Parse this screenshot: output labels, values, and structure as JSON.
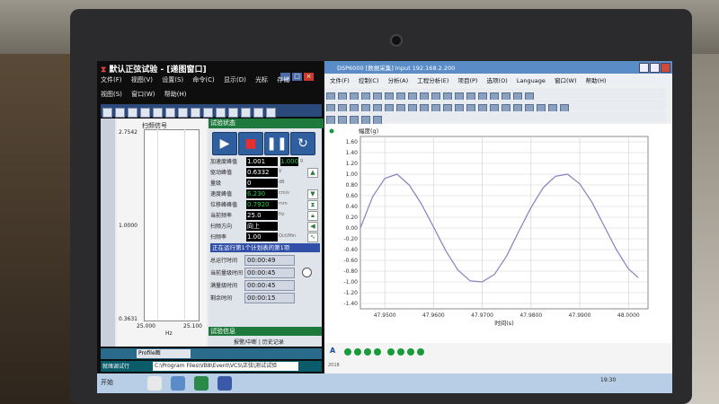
{
  "left_app": {
    "title": "默认正弦试验 - [递图窗口]",
    "menu1": [
      "文件(F)",
      "视图(V)",
      "设置(S)",
      "命令(C)",
      "显示(D)",
      "光标",
      "存储"
    ],
    "menu2": [
      "视图(S)",
      "窗口(W)",
      "帮助(H)"
    ],
    "plot": {
      "title": "扫频信号",
      "y_top": "2.7542",
      "y_mid": "1.0000",
      "y_bottom": "0.3631",
      "x_left": "25.000",
      "x_right": "25.100",
      "x_unit": "Hz"
    },
    "panel_header": "试验状态",
    "controls": [
      "play",
      "stop",
      "pause",
      "restart"
    ],
    "rows": [
      {
        "label": "加速度峰值",
        "value": "1.001",
        "value2": "1.000",
        "unit": "g"
      },
      {
        "label": "驱动峰值",
        "value": "0.6332",
        "unit": "V"
      },
      {
        "label": "量级",
        "value": "0",
        "unit": "dB"
      },
      {
        "label": "速度峰值",
        "value": "6.230",
        "unit": "cm/s"
      },
      {
        "label": "位移峰峰值",
        "value": "0.7920",
        "unit": "mm"
      },
      {
        "label": "当前频率",
        "value": "25.0",
        "unit": "Hz"
      },
      {
        "label": "扫频方向",
        "value": "向上",
        "unit": ""
      },
      {
        "label": "扫频率",
        "value": "1.00",
        "unit": "Oct/Min"
      }
    ],
    "schedule": "正在运行第1个计划表的第1项",
    "timers": [
      {
        "label": "总运行时间",
        "value": "00:00:49"
      },
      {
        "label": "当前量级时间",
        "value": "00:00:45"
      },
      {
        "label": "满量级时间",
        "value": "00:00:45"
      },
      {
        "label": "剩余时间",
        "value": "00:00:15"
      }
    ],
    "info_header": "试验信息",
    "info_tabs": "报警/中断  |  历史记录",
    "profile": "Profile图",
    "status_left": "就绪调试行",
    "status_path": "C:\\Program Files\\VB8\\Event\\VCS\\正弦\\测试试验"
  },
  "right_app": {
    "title": "DSP6000  [数据采集]  Input 192.168.2.200",
    "menu": [
      "文件(F)",
      "控制(C)",
      "分析(A)",
      "工程分析(E)",
      "项目(P)",
      "选项(O)",
      "Language",
      "窗口(W)",
      "帮助(H)"
    ],
    "status_marker": "A",
    "status_small": "2018",
    "dot_color": "#1a9a3a"
  },
  "chart_data": {
    "type": "line",
    "ylabel": "幅度(g)",
    "xlabel": "时间(s)",
    "yticks": [
      "1.60",
      "1.40",
      "1.20",
      "1.00",
      "0.80",
      "0.60",
      "0.40",
      "0.20",
      "0.00",
      "-0.20",
      "-0.40",
      "-0.60",
      "-0.80",
      "-1.00",
      "-1.20",
      "-1.40"
    ],
    "xticks": [
      "47.9500",
      "47.9600",
      "47.9700",
      "47.9800",
      "47.9900",
      "48.0000"
    ],
    "ylim": [
      -1.5,
      1.7
    ],
    "xlim": [
      47.945,
      48.004
    ],
    "series": [
      {
        "x": [
          47.945,
          47.9475,
          47.95,
          47.9525,
          47.955,
          47.9575,
          47.96,
          47.9625,
          47.965,
          47.9675,
          47.97,
          47.9725,
          47.975,
          47.9775,
          47.98,
          47.9825,
          47.985,
          47.9875,
          47.99,
          47.9925,
          47.995,
          47.9975,
          48.0,
          48.002
        ],
        "y": [
          0.0,
          0.58,
          0.92,
          1.0,
          0.8,
          0.45,
          0.02,
          -0.42,
          -0.78,
          -0.98,
          -1.0,
          -0.86,
          -0.52,
          -0.06,
          0.38,
          0.75,
          0.96,
          1.0,
          0.82,
          0.48,
          0.04,
          -0.4,
          -0.76,
          -0.92
        ]
      }
    ],
    "grid": true,
    "line_color": "#8a7fbf"
  },
  "taskbar": {
    "start_label": "开始",
    "tray_time": "19:30"
  }
}
